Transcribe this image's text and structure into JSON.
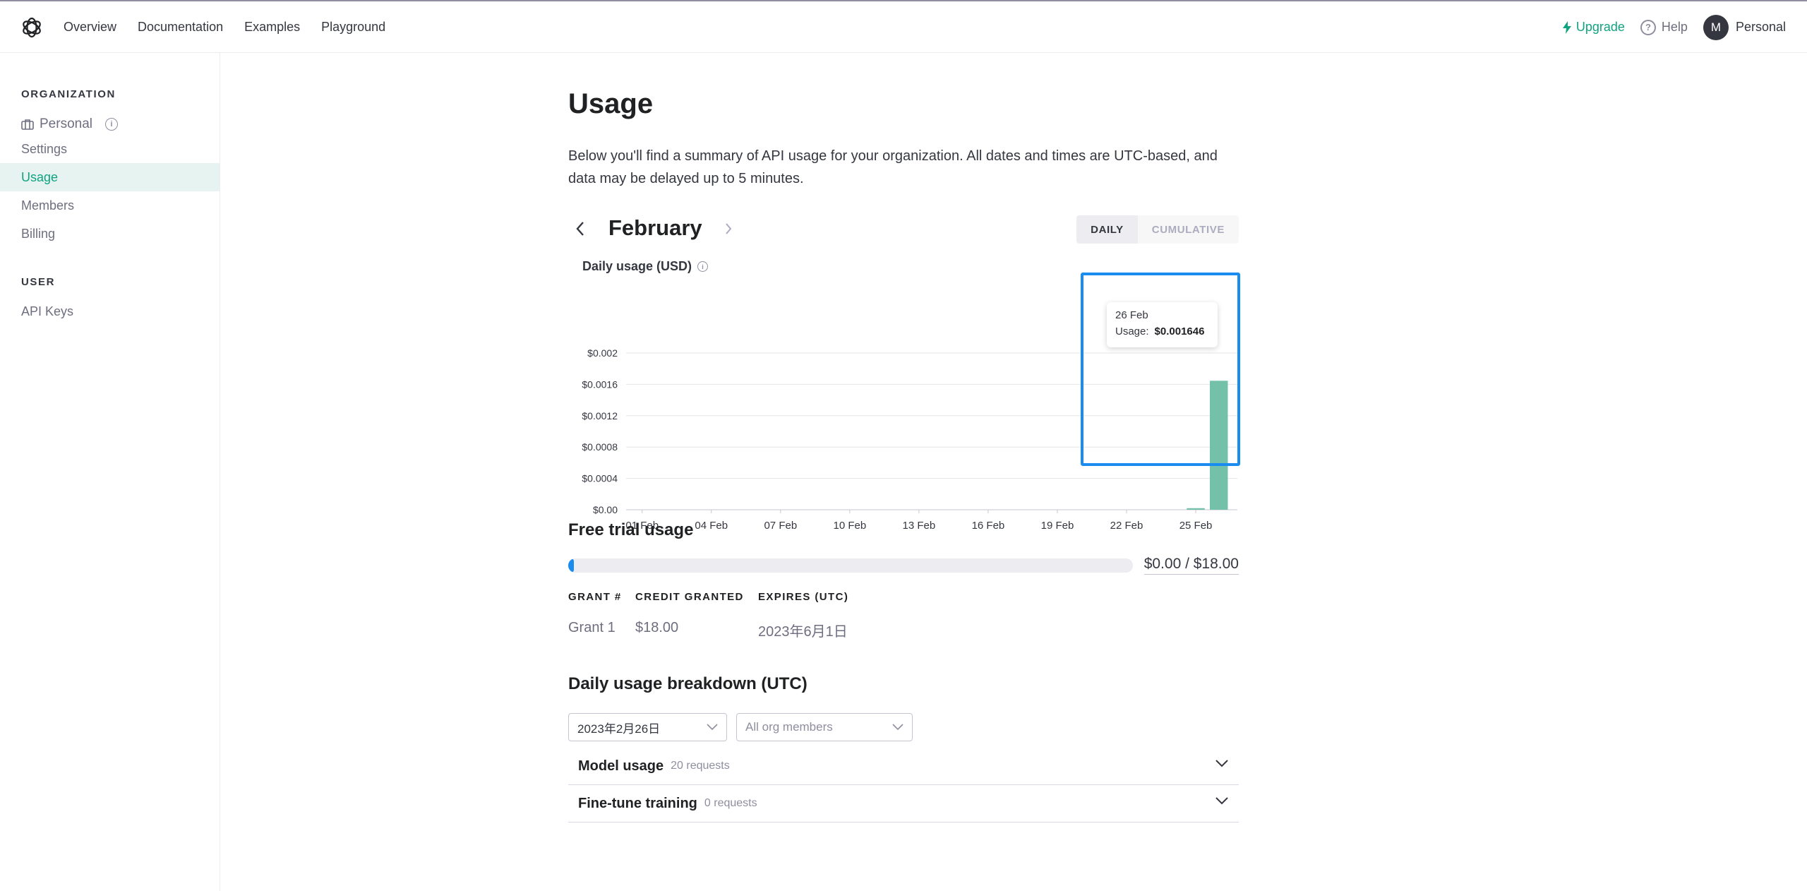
{
  "nav": {
    "links": [
      "Overview",
      "Documentation",
      "Examples",
      "Playground"
    ],
    "upgrade": "Upgrade",
    "help": "Help",
    "avatar_initial": "M",
    "account": "Personal",
    "accent": "#10a37f"
  },
  "sidebar": {
    "org_heading": "ORGANIZATION",
    "org_name": "Personal",
    "org_items": [
      "Settings",
      "Usage",
      "Members",
      "Billing"
    ],
    "active_item": "Usage",
    "user_heading": "USER",
    "user_items": [
      "API Keys"
    ]
  },
  "main": {
    "title": "Usage",
    "description": "Below you'll find a summary of API usage for your organization. All dates and times are UTC-based, and data may be delayed up to 5 minutes.",
    "month": "February",
    "toggle": [
      "DAILY",
      "CUMULATIVE"
    ],
    "toggle_selected": "DAILY",
    "chart_title": "Daily usage (USD)",
    "tooltip": {
      "date": "26 Feb",
      "label": "Usage:",
      "value": "$0.001646"
    },
    "free_trial": {
      "heading": "Free trial usage",
      "used_fraction": 0.0,
      "amount_text": "$0.00 / $18.00",
      "headers": [
        "GRANT #",
        "CREDIT GRANTED",
        "EXPIRES (UTC)"
      ],
      "rows": [
        [
          "Grant 1",
          "$18.00",
          "2023年6月1日"
        ]
      ]
    },
    "breakdown": {
      "heading": "Daily usage breakdown (UTC)",
      "date_select": "2023年2月26日",
      "member_select": "All org members",
      "sections": [
        {
          "title": "Model usage",
          "count": "20 requests"
        },
        {
          "title": "Fine-tune training",
          "count": "0 requests"
        }
      ]
    }
  },
  "chart_data": {
    "type": "bar",
    "title": "Daily usage (USD)",
    "x": [
      "01 Feb",
      "02 Feb",
      "03 Feb",
      "04 Feb",
      "05 Feb",
      "06 Feb",
      "07 Feb",
      "08 Feb",
      "09 Feb",
      "10 Feb",
      "11 Feb",
      "12 Feb",
      "13 Feb",
      "14 Feb",
      "15 Feb",
      "16 Feb",
      "17 Feb",
      "18 Feb",
      "19 Feb",
      "20 Feb",
      "21 Feb",
      "22 Feb",
      "23 Feb",
      "24 Feb",
      "25 Feb",
      "26 Feb",
      "27 Feb"
    ],
    "values": [
      0,
      0,
      0,
      0,
      0,
      0,
      0,
      0,
      0,
      0,
      0,
      0,
      0,
      0,
      0,
      0,
      0,
      0,
      0,
      0,
      0,
      0,
      0,
      0,
      2e-05,
      0.001646,
      0
    ],
    "xticks": [
      "01 Feb",
      "04 Feb",
      "07 Feb",
      "10 Feb",
      "13 Feb",
      "16 Feb",
      "19 Feb",
      "22 Feb",
      "25 Feb"
    ],
    "yticks": [
      "$0.00",
      "$0.0004",
      "$0.0008",
      "$0.0012",
      "$0.0016",
      "$0.002"
    ],
    "ylim": [
      0,
      0.002
    ],
    "grid": true,
    "bar_color": "#74c1aa"
  }
}
